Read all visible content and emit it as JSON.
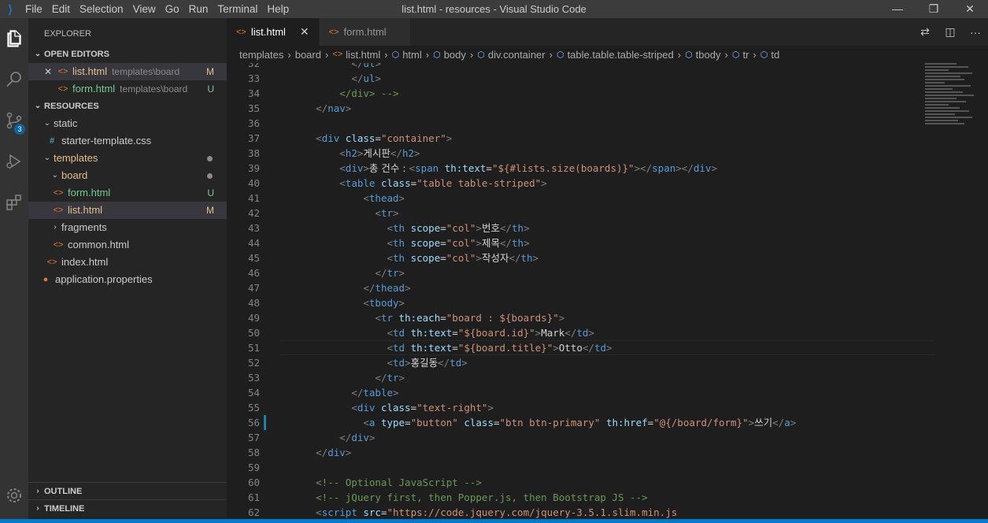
{
  "window": {
    "title": "list.html - resources - Visual Studio Code",
    "menu": [
      "File",
      "Edit",
      "Selection",
      "View",
      "Go",
      "Run",
      "Terminal",
      "Help"
    ],
    "controls": [
      "—",
      "❐",
      "✕"
    ]
  },
  "activity": {
    "scm_badge": "3"
  },
  "sidebar": {
    "title": "EXPLORER",
    "open_editors_label": "OPEN EDITORS",
    "open_editors": [
      {
        "name": "list.html",
        "desc": "templates\\board",
        "status": "M"
      },
      {
        "name": "form.html",
        "desc": "templates\\board",
        "status": "U"
      }
    ],
    "resources_label": "RESOURCES",
    "tree": {
      "static": "static",
      "css": "starter-template.css",
      "templates": "templates",
      "board": "board",
      "form": "form.html",
      "form_status": "U",
      "list": "list.html",
      "list_status": "M",
      "fragments": "fragments",
      "common": "common.html",
      "index": "index.html",
      "app_props": "application.properties"
    },
    "outline_label": "OUTLINE",
    "timeline_label": "TIMELINE"
  },
  "tabs": [
    {
      "label": "list.html",
      "close": "✕"
    },
    {
      "label": "form.html"
    }
  ],
  "breadcrumb": [
    "templates",
    "board",
    "list.html",
    "html",
    "body",
    "div.container",
    "table.table.table-striped",
    "tbody",
    "tr",
    "td"
  ],
  "lines": [
    {
      "n": "32",
      "t": "            </ul>"
    },
    {
      "n": "33",
      "t": "            </ul>"
    },
    {
      "n": "34",
      "t": "          </div> -->"
    },
    {
      "n": "35",
      "t": "      </nav>"
    },
    {
      "n": "36",
      "t": ""
    },
    {
      "n": "37",
      "t": "      <div class=\"container\">"
    },
    {
      "n": "38",
      "t": "          <h2>게시판</h2>"
    },
    {
      "n": "39",
      "t": "          <div>총 건수 : <span th:text=\"${#lists.size(boards)}\"></span></div>"
    },
    {
      "n": "40",
      "t": "          <table class=\"table table-striped\">"
    },
    {
      "n": "41",
      "t": "              <thead>"
    },
    {
      "n": "42",
      "t": "                <tr>"
    },
    {
      "n": "43",
      "t": "                  <th scope=\"col\">번호</th>"
    },
    {
      "n": "44",
      "t": "                  <th scope=\"col\">제목</th>"
    },
    {
      "n": "45",
      "t": "                  <th scope=\"col\">작성자</th>"
    },
    {
      "n": "46",
      "t": "                </tr>"
    },
    {
      "n": "47",
      "t": "              </thead>"
    },
    {
      "n": "48",
      "t": "              <tbody>"
    },
    {
      "n": "49",
      "t": "                <tr th:each=\"board : ${boards}\">"
    },
    {
      "n": "50",
      "t": "                  <td th:text=\"${board.id}\">Mark</td>"
    },
    {
      "n": "51",
      "t": "                  <td th:text=\"${board.title}\">Otto</td>"
    },
    {
      "n": "52",
      "t": "                  <td>홍길동</td>"
    },
    {
      "n": "53",
      "t": "                </tr>"
    },
    {
      "n": "54",
      "t": "            </table>"
    },
    {
      "n": "55",
      "t": "            <div class=\"text-right\">"
    },
    {
      "n": "56",
      "t": "              <a type=\"button\" class=\"btn btn-primary\" th:href=\"@{/board/form}\">쓰기</a>"
    },
    {
      "n": "57",
      "t": "          </div>"
    },
    {
      "n": "58",
      "t": "      </div>"
    },
    {
      "n": "59",
      "t": ""
    },
    {
      "n": "60",
      "t": "      <!-- Optional JavaScript -->"
    },
    {
      "n": "61",
      "t": "      <!-- jQuery first, then Popper.js, then Bootstrap JS -->"
    },
    {
      "n": "62",
      "t": "      <script src=\"https://code.jquery.com/jquery-3.5.1.slim.min.js\""
    }
  ]
}
